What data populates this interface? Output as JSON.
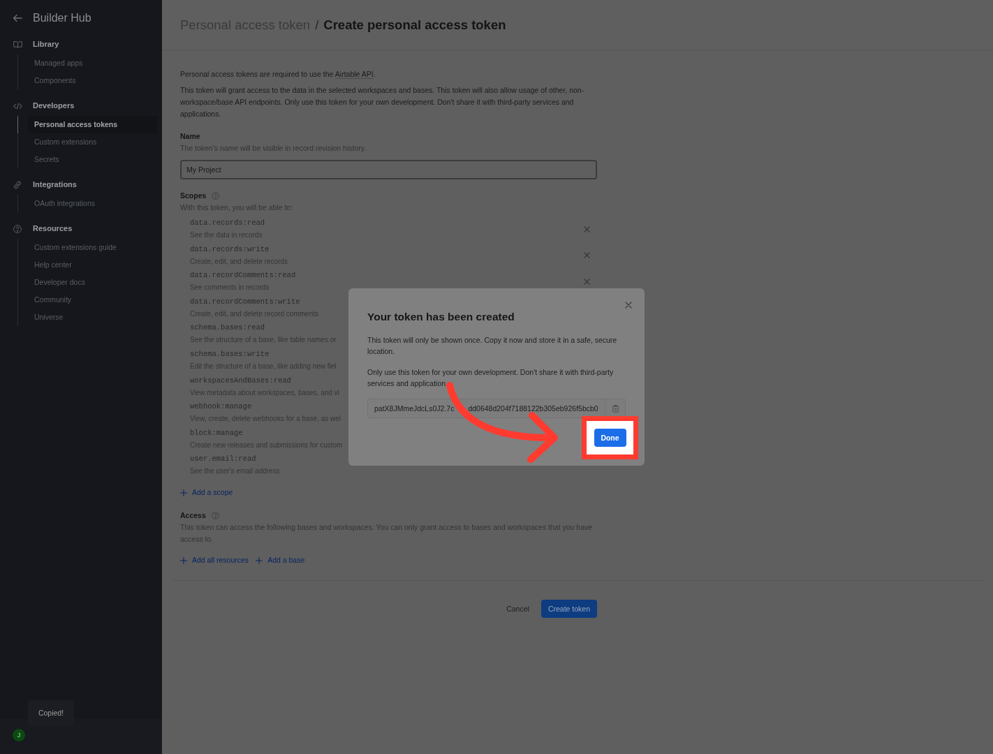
{
  "sidebar": {
    "back_title": "Builder Hub",
    "sections": [
      {
        "title": "Library",
        "items": [
          {
            "label": "Managed apps",
            "selected": false
          },
          {
            "label": "Components",
            "selected": false
          }
        ]
      },
      {
        "title": "Developers",
        "items": [
          {
            "label": "Personal access tokens",
            "selected": true
          },
          {
            "label": "Custom extensions",
            "selected": false
          },
          {
            "label": "Secrets",
            "selected": false
          }
        ]
      },
      {
        "title": "Integrations",
        "items": [
          {
            "label": "OAuth integrations",
            "selected": false
          }
        ]
      },
      {
        "title": "Resources",
        "items": [
          {
            "label": "Custom extensions guide",
            "selected": false
          },
          {
            "label": "Help center",
            "selected": false
          },
          {
            "label": "Developer docs",
            "selected": false
          },
          {
            "label": "Community",
            "selected": false
          },
          {
            "label": "Universe",
            "selected": false
          }
        ]
      }
    ],
    "avatar_initial": "J",
    "toast": "Copied!"
  },
  "header": {
    "parent": "Personal access token",
    "separator": "/",
    "title": "Create personal access token"
  },
  "intro": {
    "text_before": "Personal access tokens are required to use the ",
    "link": "Airtable API",
    "text_after": "."
  },
  "notice": "This token will grant access to the data in the selected workspaces and bases. This token will also allow usage of other, non-workspace/base API endpoints. Only use this token for your own development. Don't share it with third-party services and applications.",
  "name_field": {
    "label": "Name",
    "hint": "The token's name will be visible in record revision history.",
    "value": "My Project"
  },
  "scopes": {
    "label": "Scopes",
    "hint": "With this token, you will be able to:",
    "items": [
      {
        "code": "data.records:read",
        "description": "See the data in records",
        "covered": false
      },
      {
        "code": "data.records:write",
        "description": "Create, edit, and delete records",
        "covered": false
      },
      {
        "code": "data.recordComments:read",
        "description": "See comments in records",
        "covered": false
      },
      {
        "code": "data.recordComments:write",
        "description": "Create, edit, and delete record comments",
        "covered": true
      },
      {
        "code": "schema.bases:read",
        "description": "See the structure of a base, like table names or",
        "covered": true
      },
      {
        "code": "schema.bases:write",
        "description": "Edit the structure of a base, like adding new fiel",
        "covered": true
      },
      {
        "code": "workspacesAndBases:read",
        "description": "View metadata about workspaces, bases, and vi",
        "covered": true
      },
      {
        "code": "webhook:manage",
        "description": "View, create, delete webhooks for a base, as wel",
        "covered": true
      },
      {
        "code": "block:manage",
        "description": "Create new releases and submissions for custom",
        "covered": true
      },
      {
        "code": "user.email:read",
        "description": "See the user's email address",
        "covered": true
      }
    ],
    "add_link": "Add a scope"
  },
  "access": {
    "label": "Access",
    "hint": "This token can access the following bases and workspaces. You can only grant access to bases and workspaces that you have access to.",
    "links": [
      "Add all resources",
      "Add a base"
    ]
  },
  "actions": {
    "cancel": "Cancel",
    "submit": "Create token"
  },
  "dialog": {
    "title": "Your token has been created",
    "paragraphs": [
      "This token will only be shown once. Copy it now and store it in a safe, secure location.",
      "Only use this token for your own development. Don't share it with third-party services and application"
    ],
    "token_start": "patX8JMmeJdcLs0J2.7c",
    "token_end": "dd0648d204f7188122b305eb926f5bcb0",
    "done": "Done"
  }
}
